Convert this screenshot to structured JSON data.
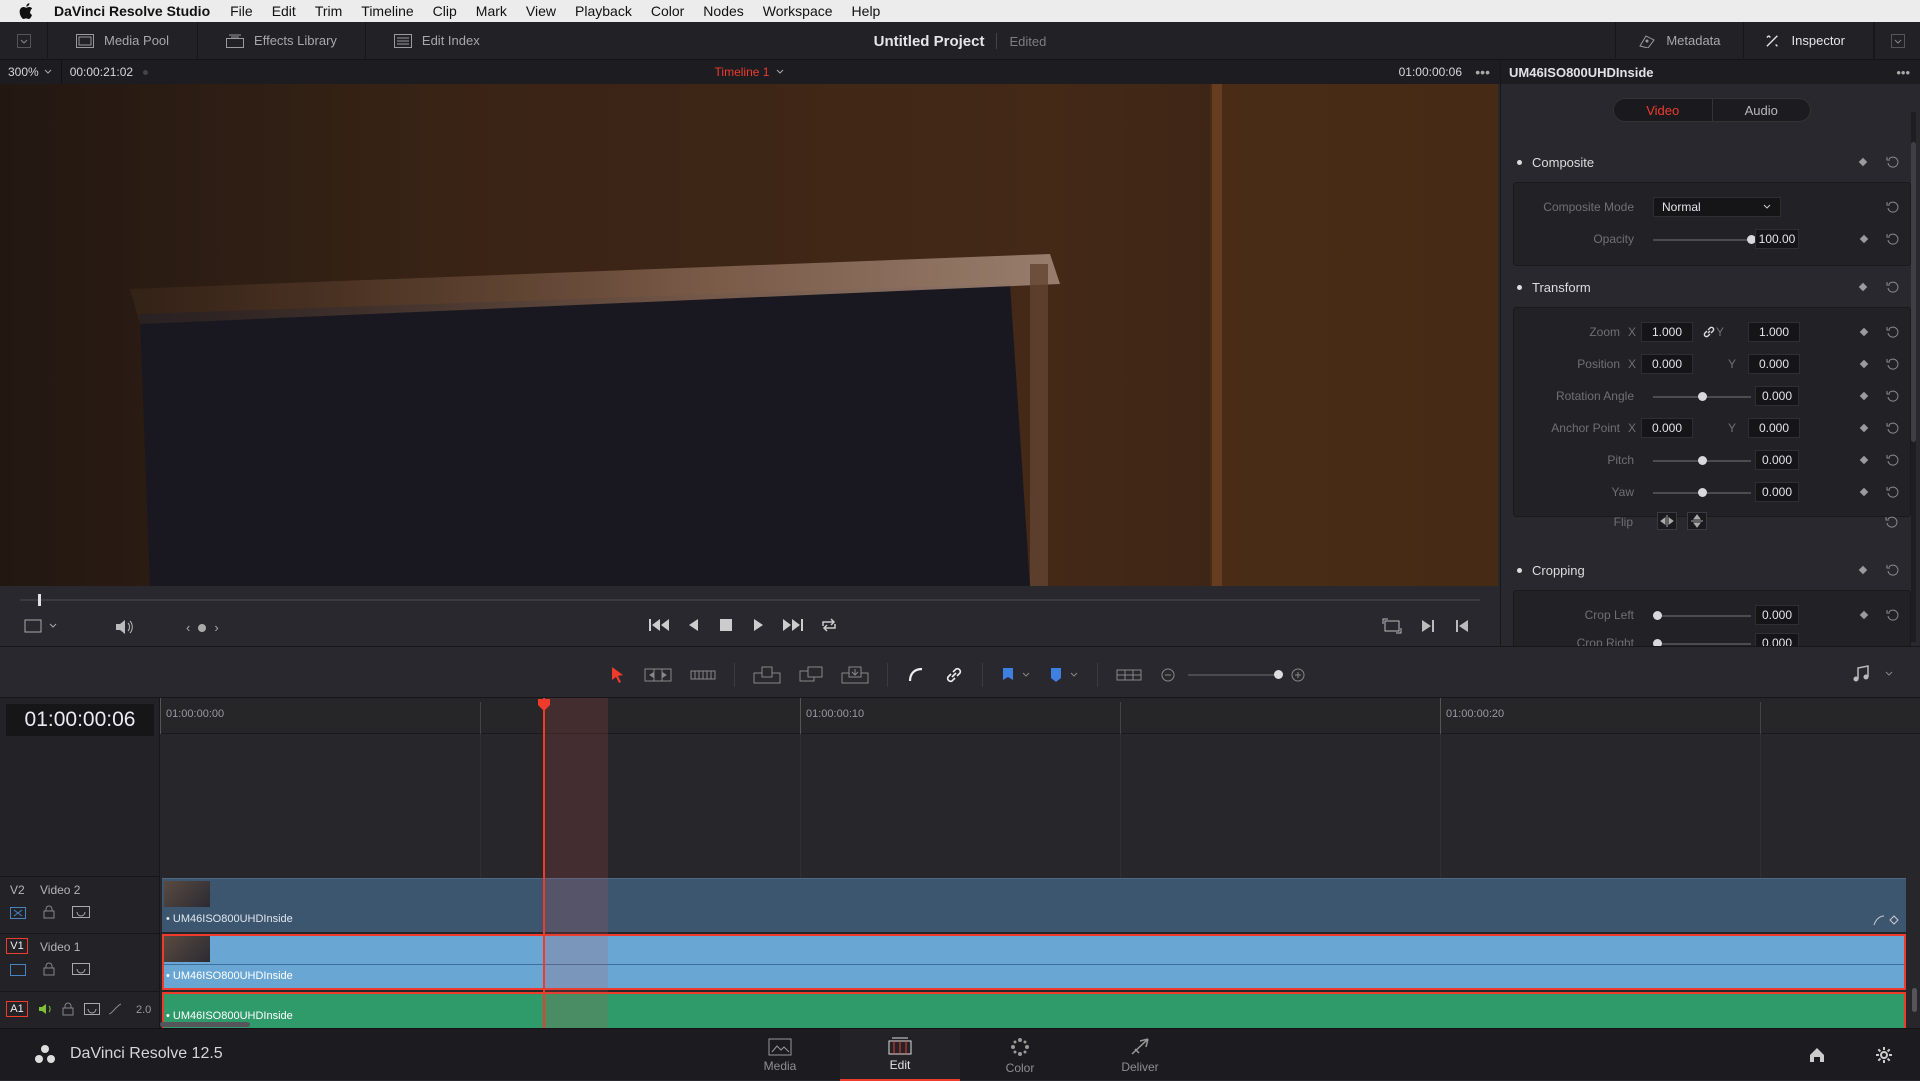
{
  "menubar": {
    "app_name": "DaVinci Resolve Studio",
    "items": [
      "File",
      "Edit",
      "Trim",
      "Timeline",
      "Clip",
      "Mark",
      "View",
      "Playback",
      "Color",
      "Nodes",
      "Workspace",
      "Help"
    ]
  },
  "header": {
    "media_pool": "Media Pool",
    "effects_library": "Effects Library",
    "edit_index": "Edit Index",
    "project_title": "Untitled Project",
    "project_status": "Edited",
    "metadata": "Metadata",
    "inspector": "Inspector"
  },
  "viewer": {
    "zoom": "300%",
    "source_timecode": "00:00:21:02",
    "timeline_name": "Timeline 1",
    "record_timecode": "01:00:00:06"
  },
  "inspector": {
    "clip_name": "UM46ISO800UHDInside",
    "tabs": [
      "Video",
      "Audio"
    ],
    "composite": {
      "title": "Composite",
      "mode_label": "Composite Mode",
      "mode_value": "Normal",
      "opacity_label": "Opacity",
      "opacity_value": "100.00",
      "opacity_level": 1.0
    },
    "transform": {
      "title": "Transform",
      "zoom_label": "Zoom",
      "zoom_x": "1.000",
      "zoom_y": "1.000",
      "position_label": "Position",
      "position_x": "0.000",
      "position_y": "0.000",
      "rotation_label": "Rotation Angle",
      "rotation_value": "0.000",
      "anchor_label": "Anchor Point",
      "anchor_x": "0.000",
      "anchor_y": "0.000",
      "pitch_label": "Pitch",
      "pitch_value": "0.000",
      "yaw_label": "Yaw",
      "yaw_value": "0.000",
      "flip_label": "Flip",
      "x_label": "X",
      "y_label": "Y"
    },
    "cropping": {
      "title": "Cropping",
      "crop_left_label": "Crop Left",
      "crop_left_value": "0.000",
      "crop_right_label": "Crop Right",
      "crop_right_value": "0.000"
    }
  },
  "timeline": {
    "timecode": "01:00:00:06",
    "ruler": [
      "01:00:00:00",
      "01:00:00:10",
      "01:00:00:20"
    ],
    "tracks": [
      {
        "id": "V2",
        "name": "Video 2",
        "clip": "UM46ISO800UHDInside"
      },
      {
        "id": "V1",
        "name": "Video 1",
        "clip": "UM46ISO800UHDInside"
      },
      {
        "id": "A1",
        "name": "",
        "clip": "UM46ISO800UHDInside",
        "channels": "2.0"
      }
    ]
  },
  "pagebar": {
    "product": "DaVinci Resolve 12.5",
    "pages": [
      "Media",
      "Edit",
      "Color",
      "Deliver"
    ],
    "active_page": "Edit"
  },
  "colors": {
    "accent": "#ef3a2c",
    "v1_clip": "#6aa6d4",
    "v2_clip": "#3d5670",
    "audio_clip": "#2f9a6a"
  }
}
